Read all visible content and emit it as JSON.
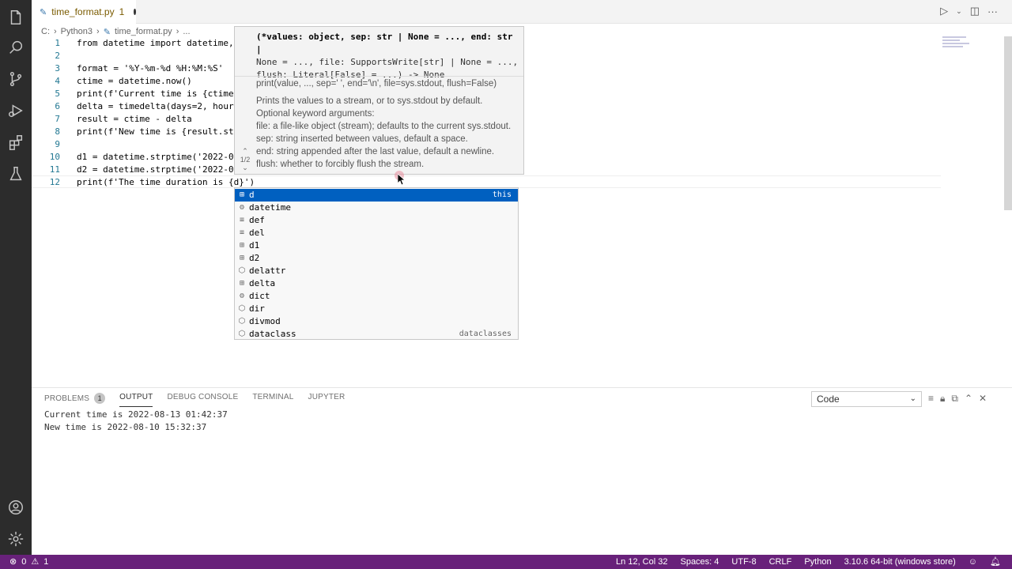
{
  "colors": {
    "activity_bar": "#2c2c2c",
    "status_bar": "#68217a",
    "selection": "#0060c0"
  },
  "tab": {
    "filename": "time_format.py",
    "problems_count": "1"
  },
  "breadcrumb": [
    "C:",
    "Python3",
    "time_format.py",
    "..."
  ],
  "code_lines": [
    {
      "num": "1",
      "text": "from datetime import datetime,"
    },
    {
      "num": "2",
      "text": ""
    },
    {
      "num": "3",
      "text": "format = '%Y-%m-%d %H:%M:%S'"
    },
    {
      "num": "4",
      "text": "ctime = datetime.now()"
    },
    {
      "num": "5",
      "text": "print(f'Current time is {ctime."
    },
    {
      "num": "6",
      "text": "delta = timedelta(days=2, hours"
    },
    {
      "num": "7",
      "text": "result = ctime - delta"
    },
    {
      "num": "8",
      "text": "print(f'New time is {result.str"
    },
    {
      "num": "9",
      "text": ""
    },
    {
      "num": "10",
      "text": "d1 = datetime.strptime('2022-08"
    },
    {
      "num": "11",
      "text": "d2 = datetime.strptime('2022-05"
    },
    {
      "num": "12",
      "text": "print(f'The time duration is {d}')"
    }
  ],
  "signature": {
    "line1": "(*values: object, sep: str | None = ..., end: str |",
    "line2": "None = ..., file: SupportsWrite[str] | None = ...,",
    "line3": "flush: Literal[False] = ...) -> None",
    "nav": "1/2",
    "doc": [
      "print(value, ..., sep=' ', end='\\n', file=sys.stdout, flush=False)",
      "",
      "Prints the values to a stream, or to sys.stdout by default.",
      "Optional keyword arguments:",
      "file: a file-like object (stream); defaults to the current sys.stdout.",
      "sep: string inserted between values, default a space.",
      "end: string appended after the last value, default a newline.",
      "flush: whether to forcibly flush the stream."
    ]
  },
  "suggestions": [
    {
      "label": "d",
      "kind": "variable",
      "icon": "variable-icon",
      "detail": "this",
      "selected": true
    },
    {
      "label": "datetime",
      "kind": "class",
      "icon": "class-icon",
      "detail": ""
    },
    {
      "label": "def",
      "kind": "keyword",
      "icon": "keyword-icon",
      "detail": ""
    },
    {
      "label": "del",
      "kind": "keyword",
      "icon": "keyword-icon",
      "detail": ""
    },
    {
      "label": "d1",
      "kind": "variable",
      "icon": "variable-icon",
      "detail": ""
    },
    {
      "label": "d2",
      "kind": "variable",
      "icon": "variable-icon",
      "detail": ""
    },
    {
      "label": "delattr",
      "kind": "function",
      "icon": "function-icon",
      "detail": ""
    },
    {
      "label": "delta",
      "kind": "variable",
      "icon": "variable-icon",
      "detail": ""
    },
    {
      "label": "dict",
      "kind": "class",
      "icon": "class-icon",
      "detail": ""
    },
    {
      "label": "dir",
      "kind": "function",
      "icon": "function-icon",
      "detail": ""
    },
    {
      "label": "divmod",
      "kind": "function",
      "icon": "function-icon",
      "detail": ""
    },
    {
      "label": "dataclass",
      "kind": "function",
      "icon": "function-icon",
      "detail": "dataclasses"
    }
  ],
  "panel": {
    "tabs": [
      "PROBLEMS",
      "OUTPUT",
      "DEBUG CONSOLE",
      "TERMINAL",
      "JUPYTER"
    ],
    "active_tab": "OUTPUT",
    "problems_badge": "1",
    "output_channel": "Code",
    "output_lines": [
      "Current time is 2022-08-13 01:42:37",
      "New time is 2022-08-10 15:32:37"
    ]
  },
  "status": {
    "errors": "0",
    "warnings": "1",
    "position": "Ln 12, Col 32",
    "spaces": "Spaces: 4",
    "encoding": "UTF-8",
    "eol": "CRLF",
    "language": "Python",
    "interpreter": "3.10.6 64-bit (windows store)"
  }
}
